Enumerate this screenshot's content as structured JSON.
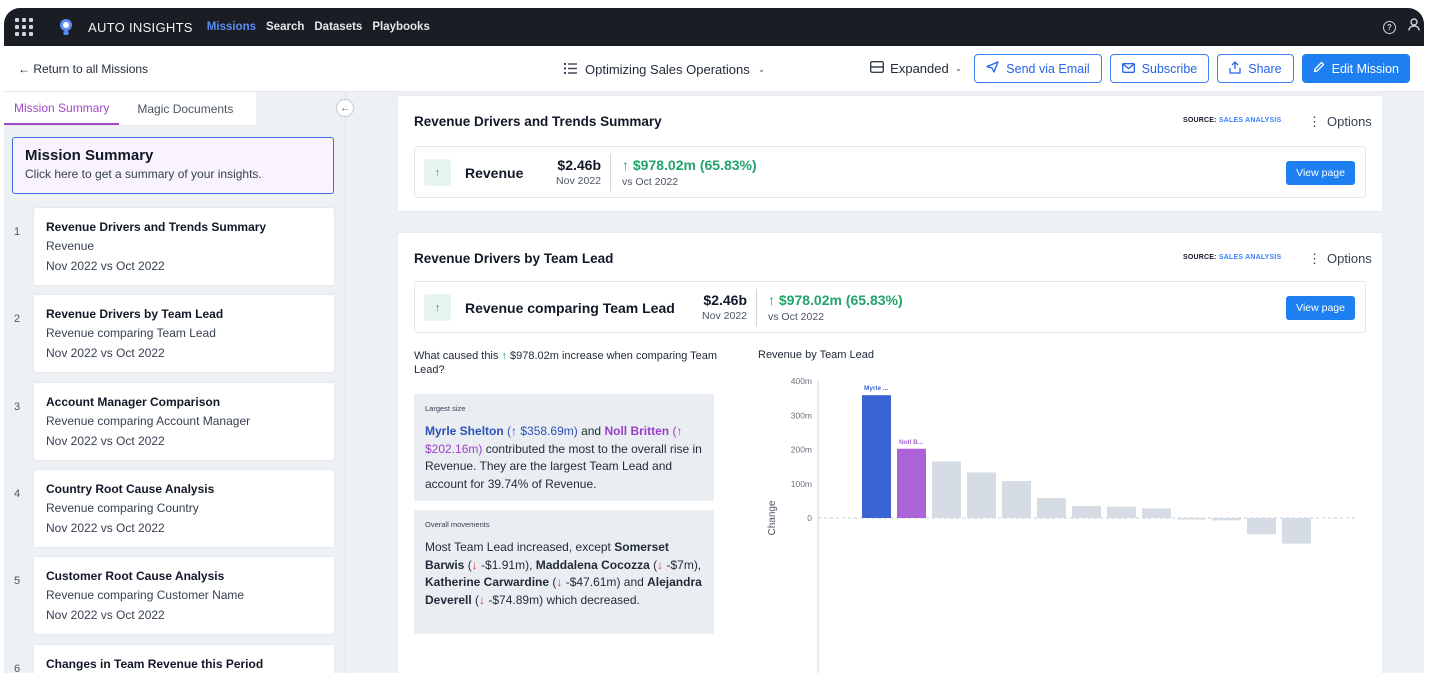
{
  "topnav": {
    "brand": "AUTO INSIGHTS",
    "links": [
      "Missions",
      "Search",
      "Datasets",
      "Playbooks"
    ],
    "help_icon_label": "?"
  },
  "toolbar": {
    "back_label": "← Return to all Missions",
    "mission_name": "Optimizing Sales Operations",
    "view_mode": "Expanded",
    "email_label": "Send via Email",
    "subscribe_label": "Subscribe",
    "share_label": "Share",
    "edit_label": "Edit Mission"
  },
  "sidebar": {
    "tabs": [
      "Mission Summary",
      "Magic Documents"
    ],
    "summary_card": {
      "title": "Mission Summary",
      "subtitle": "Click here to get a summary of your insights."
    },
    "items": [
      {
        "num": "1",
        "title": "Revenue Drivers and Trends Summary",
        "sub": "Revenue",
        "period": "Nov 2022 vs Oct 2022"
      },
      {
        "num": "2",
        "title": "Revenue Drivers by Team Lead",
        "sub": "Revenue comparing Team Lead",
        "period": "Nov 2022 vs Oct 2022"
      },
      {
        "num": "3",
        "title": "Account Manager Comparison",
        "sub": "Revenue comparing Account Manager",
        "period": "Nov 2022 vs Oct 2022"
      },
      {
        "num": "4",
        "title": "Country Root Cause Analysis",
        "sub": "Revenue comparing Country",
        "period": "Nov 2022 vs Oct 2022"
      },
      {
        "num": "5",
        "title": "Customer Root Cause Analysis",
        "sub": "Revenue comparing Customer Name",
        "period": "Nov 2022 vs Oct 2022"
      },
      {
        "num": "6",
        "title": "Changes in Team Revenue this Period",
        "sub": "",
        "period": ""
      }
    ]
  },
  "panels": [
    {
      "title": "Revenue Drivers and Trends Summary",
      "source_label": "SOURCE:",
      "source_name": "SALES ANALYSIS",
      "options_label": "Options",
      "metric": {
        "name": "Revenue",
        "value": "$2.46b",
        "date": "Nov 2022",
        "change": "↑ $978.02m (65.83%)",
        "compare": "vs Oct 2022",
        "button": "View page"
      }
    },
    {
      "title": "Revenue Drivers by Team Lead",
      "source_label": "SOURCE:",
      "source_name": "SALES ANALYSIS",
      "options_label": "Options",
      "metric": {
        "name": "Revenue comparing Team Lead",
        "value": "$2.46b",
        "date": "Nov 2022",
        "change": "↑ $978.02m (65.83%)",
        "compare": "vs Oct 2022",
        "button": "View page"
      },
      "question_pre": "What caused this",
      "question_arrow": "↑",
      "question_post": "$978.02m increase when comparing Team Lead?",
      "insights": [
        {
          "label": "Largest size",
          "name1": "Myrle Shelton",
          "val1": "(↑ $358.69m)",
          "join": "and",
          "name2": "Noll Britten",
          "val2": "(↑ $202.16m)",
          "rest": "contributed the most to the overall rise in Revenue. They are the largest Team Lead and account for 39.74% of Revenue."
        },
        {
          "label": "Overall movements",
          "intro": "Most Team Lead increased, except",
          "p1_name": "Somerset Barwis",
          "p1_val": "-$1.91m",
          "p2_name": "Maddalena Cocozza",
          "p2_val": "-$7m",
          "p3_name": "Katherine Carwardine",
          "p3_val": "-$47.61m",
          "p4_name": "Alejandra Deverell",
          "p4_val": "-$74.89m",
          "down_arrow": "↓",
          "outro": "which decreased."
        }
      ]
    }
  ],
  "chart_data": {
    "type": "bar",
    "title": "Revenue by Team Lead",
    "ylabel": "Change",
    "ylim": [
      -70,
      400
    ],
    "yticks": [
      0,
      100,
      200,
      300,
      400
    ],
    "ytick_labels": [
      "0",
      "100m",
      "200m",
      "300m",
      "400m"
    ],
    "categories": [
      "Myrle ...",
      "Noll B...",
      "",
      "",
      "",
      "",
      "",
      "",
      "",
      "",
      "",
      "",
      ""
    ],
    "values": [
      358.69,
      202.16,
      165,
      133,
      108,
      58,
      35,
      33,
      28,
      -1.91,
      -7,
      -47.61,
      -74.89
    ],
    "colors": {
      "highlight1": "#3b63d1",
      "highlight2": "#ad63d8",
      "other": "#d5dce3"
    }
  }
}
